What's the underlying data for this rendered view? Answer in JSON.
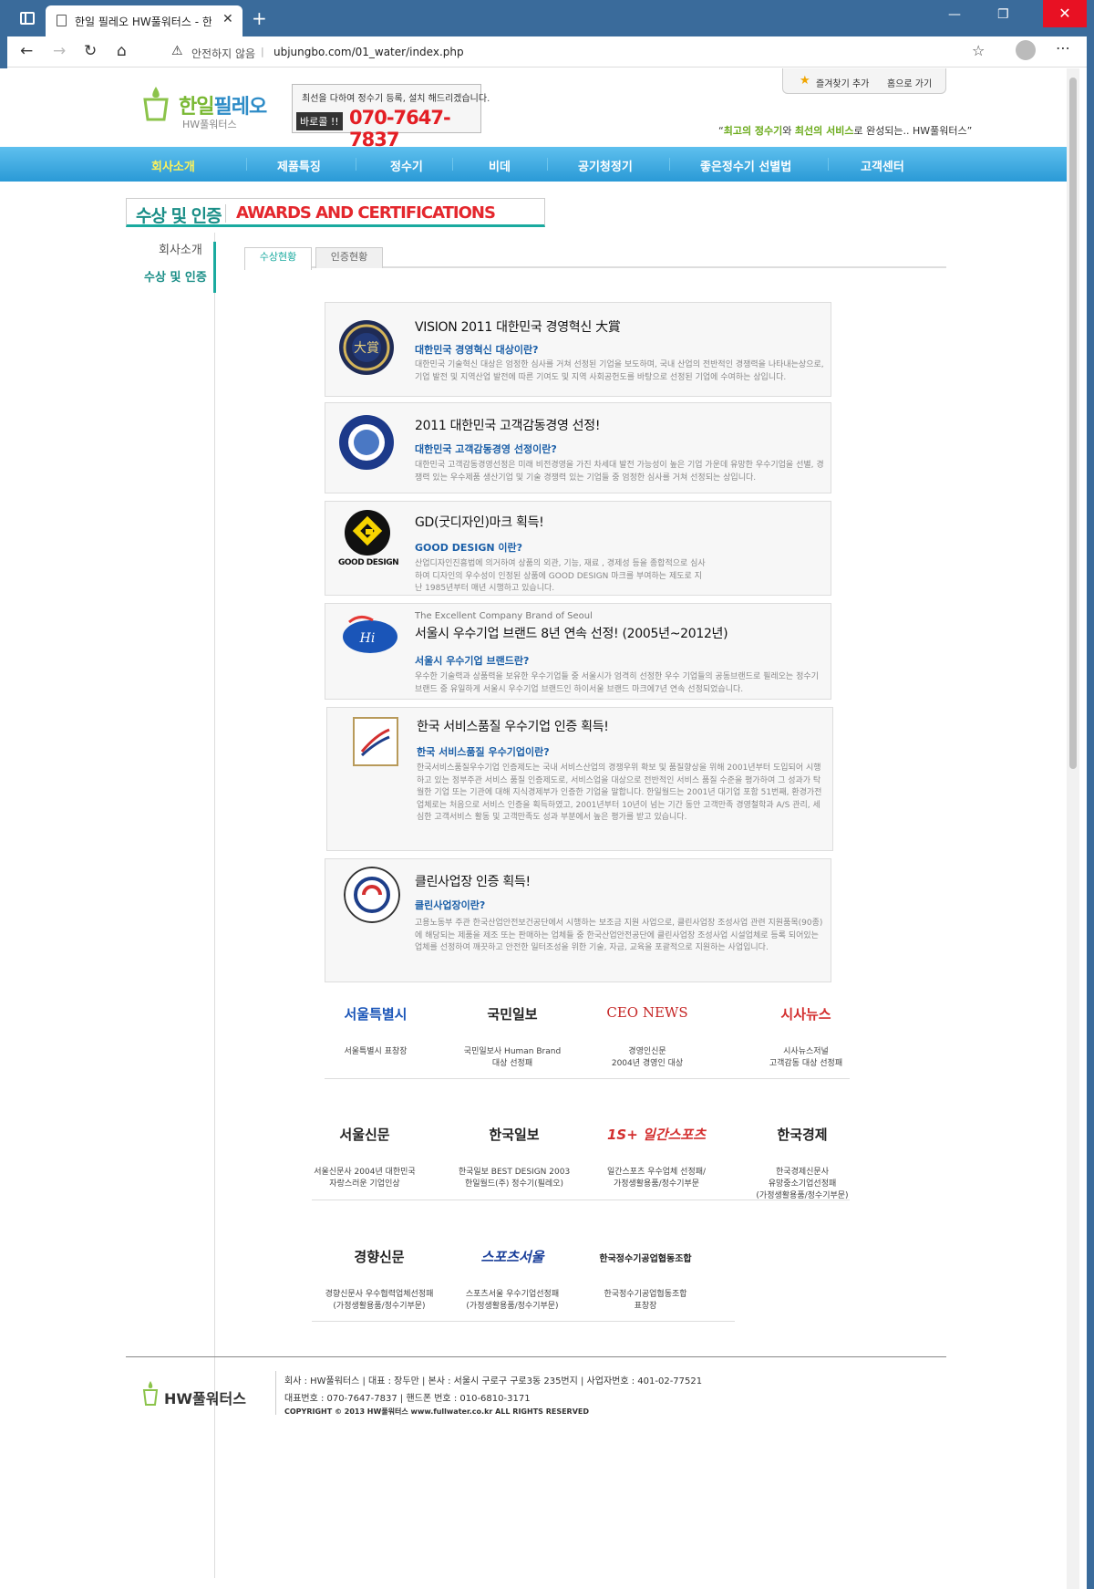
{
  "browser": {
    "tab_title": "한일 필레오 HW풀워터스 - 한일",
    "url_warning": "안전하지 않음",
    "url": "ubjungbo.com/01_water/index.php"
  },
  "header": {
    "logo_main": "한일",
    "logo_main2": "필레오",
    "logo_sub": "HW풀워터스",
    "call_message": "최선을 다하여 정수기 등록, 설치 해드리겠습니다.",
    "call_badge": "바로콜 !!",
    "call_number": "070-7647-7837",
    "bookmark_label": "즐겨찾기 추가",
    "home_label": "홈으로 가기",
    "slogan_pre": "“",
    "slogan_hl1": "최고의 정수기",
    "slogan_mid": "와 ",
    "slogan_hl2": "최선의 서비스",
    "slogan_post": "로 완성되는.. HW풀워터스”"
  },
  "gnb": [
    "회사소개",
    "제품특징",
    "정수기",
    "비데",
    "공기청정기",
    "좋은정수기 선별법",
    "고객센터"
  ],
  "section": {
    "title_ko": "수상 및 인증",
    "title_en": "AWARDS AND CERTIFICATIONS"
  },
  "lnb": [
    "회사소개",
    "수상 및 인증"
  ],
  "subtabs": [
    "수상현황",
    "인증현황"
  ],
  "awards": [
    {
      "title": "VISION 2011 대한민국 경영혁신 大賞",
      "question": "대한민국 경영혁신 대상이란?",
      "desc": "대한민국 기술혁신 대상은 엄정한 심사를 거쳐 선정된 기업을 보도하며, 국내 산업의 전반적인 경쟁력을 나타내는상으로, 기업 발전 및 지역산업 발전에 따른 기여도 및 지역 사회공헌도를 바탕으로 선정된 기업에 수여하는 상입니다."
    },
    {
      "title": "2011 대한민국 고객감동경영 선정!",
      "question": "대한민국 고객감동경영 선정이란?",
      "desc": "대한민국 고객감동경영선정은 미래 비전경영을 가진 차세대 발전 가능성이 높은 기업 가운데 유망한 우수기업을 선별, 경쟁력 있는 우수제품 생산기업 및 기술 경쟁력 있는 기업들 중 엄정한 심사를 거쳐 선정되는 상입니다."
    },
    {
      "title": "GD(굿디자인)마크 획득!",
      "question": "GOOD DESIGN 이란?",
      "logo_caption": "GOOD DESIGN",
      "desc": "산업디자인진흥법에 의거하여 상품의 외관, 기능, 재료 , 경제성 등을 종합적으로 심사하여 디자인의 우수성이 인정된 상품에 GOOD DESIGN 마크를 부여하는 제도로 지난 1985년부터 매년 시행하고 있습니다."
    },
    {
      "pre": "The Excellent Company Brand of Seoul",
      "title": "서울시 우수기업 브랜드 8년 연속 선정! (2005년~2012년)",
      "question": "서울시 우수기업 브랜드란?",
      "desc": "우수한 기술력과 상품력을 보유한 우수기업들 중 서울시가 엄격히 선정한 우수 기업들의 공동브랜드로 필레오는 정수기 브랜드 중 유일하게 서울시 우수기업 브랜드인 하이서울 브랜드 마크에7년 연속 선정되었습니다."
    },
    {
      "title": "한국 서비스품질 우수기업 인증 획득!",
      "question": "한국 서비스품질 우수기업이란?",
      "desc": "한국서비스품질우수기업 인증제도는 국내 서비스산업의 경쟁우위 확보 및 품질향상을 위해 2001년부터 도입되어 시행하고 있는 정부주관 서비스 품질 인증제도로, 서비스업을 대상으로 전반적인 서비스 품질 수준을 평가하여 그 성과가 탁월한 기업 또는 기관에 대해 지식경제부가 인증한 기업을 말합니다. 한일월드는 2001년 대기업 포함 51번째, 환경가전업체로는 처음으로 서비스 인증을 획득하였고, 2001년부터 10년이 넘는 기간 동안 고객만족 경영철학과 A/S 관리, 세심한 고객서비스 활동 및 고객만족도 성과 부분에서 높은 평가를 받고 있습니다."
    },
    {
      "title": "클린사업장 인증 획득!",
      "question": "클린사업장이란?",
      "desc": "고용노동부 주관 한국산업안전보건공단에서 시행하는 보조금 지원 사업으로, 클린사업장 조성사업 관련 지원품목(90종)에 해당되는 제품을 제조 또는 판매하는 업체들 중 한국산업안전공단에 클린사업장 조성사업 시설업체로 등록 되어있는 업체를 선정하여 깨끗하고 안전한 일터조성을 위한 기술, 자금, 교육을 포괄적으로 지원하는 사업입니다."
    }
  ],
  "press": [
    {
      "logo": "서울특별시",
      "cap1": "서울특별시 표창장",
      "cap2": "",
      "cap3": ""
    },
    {
      "logo": "국민일보",
      "cap1": "국민일보사 Human Brand",
      "cap2": "대상 선정패",
      "cap3": ""
    },
    {
      "logo": "CEO NEWS",
      "cap1": "경영인신문",
      "cap2": "2004년 경영인 대상",
      "cap3": ""
    },
    {
      "logo": "시사뉴스",
      "cap1": "시사뉴스저널",
      "cap2": "고객감동 대상 선정패",
      "cap3": ""
    },
    {
      "logo": "서울신문",
      "cap1": "서울신문사 2004년 대한민국",
      "cap2": "자랑스러운 기업인상",
      "cap3": ""
    },
    {
      "logo": "한국일보",
      "cap1": "한국일보 BEST DESIGN 2003",
      "cap2": "한일월드(주) 정수기(필레오)",
      "cap3": ""
    },
    {
      "logo": "1S+ 일간스포츠",
      "cap1": "일간스포츠 우수업체 선정패/",
      "cap2": "가정생활용품/정수기부문",
      "cap3": ""
    },
    {
      "logo": "한국경제",
      "cap1": "한국경제신문사",
      "cap2": "유망중소기업선정패",
      "cap3": "(가정생활용품/정수기부문)"
    },
    {
      "logo": "경향신문",
      "cap1": "경향신문사 우수협력업체선정패",
      "cap2": "(가정생활용품/정수기부문)",
      "cap3": ""
    },
    {
      "logo": "스포츠서울",
      "cap1": "스포츠서울 우수기업선정패",
      "cap2": "(가정생활용품/정수기부문)",
      "cap3": ""
    },
    {
      "logo": "한국정수기공업협동조합",
      "cap1": "한국정수기공업협동조합",
      "cap2": "표창장",
      "cap3": ""
    }
  ],
  "footer": {
    "logo": "HW풀워터스",
    "line1": "회사 : HW풀워터스  |  대표 : 장두만  |  본사 : 서울시 구로구 구로3동 235번지  |  사업자번호 : 401-02-77521",
    "line2": "대표번호 : 070-7647-7837  |  핸드폰 번호 : 010-6810-3171",
    "line3": "COPYRIGHT © 2013   HW풀워터스 www.fullwater.co.kr   ALL RIGHTS RESERVED"
  },
  "colors": {
    "accent": "#1aaa9f",
    "gnb": "#2a9ad6",
    "red": "#e4272d",
    "link": "#1b5fa8"
  }
}
